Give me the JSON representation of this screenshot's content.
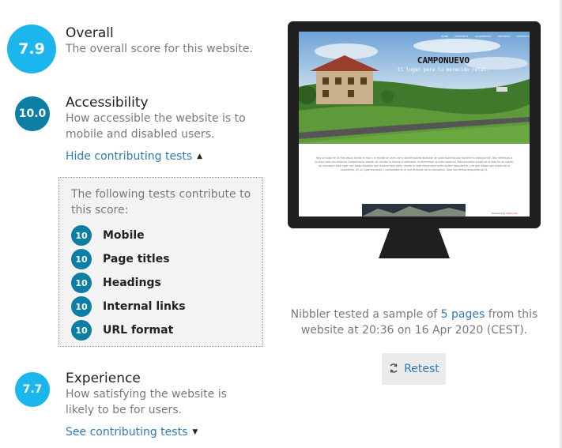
{
  "overall": {
    "score": "7.9",
    "title": "Overall",
    "desc": "The overall score for this website."
  },
  "accessibility": {
    "score": "10.0",
    "title": "Accessibility",
    "desc": "How accessible the website is to mobile and disabled users.",
    "toggle_label": "Hide contributing tests",
    "tests_intro": "The following tests contribute to this score:",
    "tests": [
      {
        "score": "10",
        "name": "Mobile"
      },
      {
        "score": "10",
        "name": "Page titles"
      },
      {
        "score": "10",
        "name": "Headings"
      },
      {
        "score": "10",
        "name": "Internal links"
      },
      {
        "score": "10",
        "name": "URL format"
      }
    ]
  },
  "experience": {
    "score": "7.7",
    "title": "Experience",
    "desc": "How satisfying the website is likely to be for users.",
    "toggle_label": "See contributing tests"
  },
  "preview": {
    "site_title": "CAMPONUEVO",
    "site_tagline": "El lugar para tu merecido relax.",
    "nav": [
      "HOME",
      "NOSOTROS",
      "ALOJAMIENTO",
      "ENTORNO",
      "CONTACTO"
    ],
    "body_text": "Hoy un lugar en el País Vasco donde el mar y el monte se unen con y donde podrás disfrutar de unas espectacular durante tu estancia allí. Nos referimos a la casa rural con encanto Camponuevo, donde, sin olvidar la esencia tradicional, le ofrecemos un trato especial. Este proyecto surgió de la idea de un sueño: de conseguir este lugar con todas aquellas que durante días atrás, donde la vida nueva para quien quiere descubrirla, y es que dispon por medio de la naturaleza, en un lugar tranquilo y confortable en el que disfrutar de la naturaleza. Todo nos hemos dispuesto por ti.",
    "footer_left": "Powered by",
    "footer_right": "Webnode"
  },
  "sample": {
    "prefix": "Nibbler tested a sample of",
    "pages_link": "5 pages",
    "suffix": "from this website at 20:36 on 16 Apr 2020 (CEST)."
  },
  "retest_label": "Retest",
  "colors": {
    "score_light": "#1bb7ec",
    "score_dark": "#0d7ea4",
    "link": "#2c7bb6"
  }
}
